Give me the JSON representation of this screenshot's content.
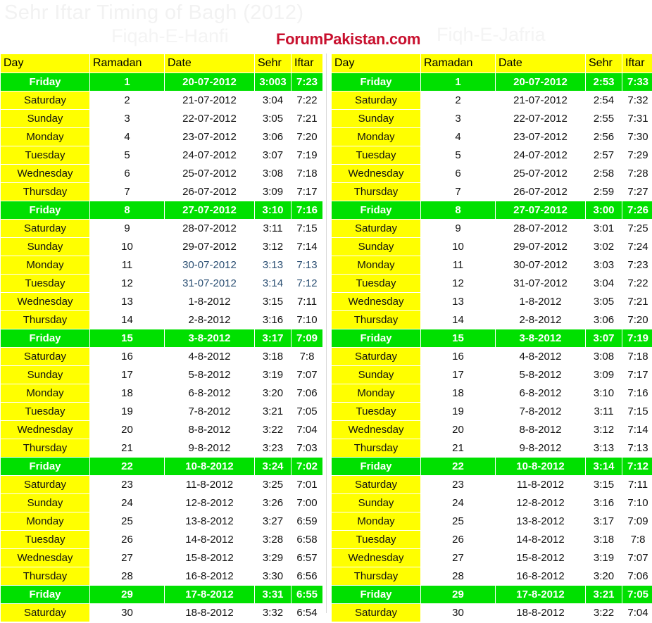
{
  "header": {
    "main_title": "Sehr Iftar Timing of Bagh (2012)",
    "subtitle_left": "Fiqah-E-Hanfi",
    "subtitle_right": "Fiqh-E-Jafria",
    "brand": "ForumPakistan.com",
    "brand_color": "#c8102e",
    "title_color": "#f2f2f2"
  },
  "colors": {
    "header_row_bg": "#ffff00",
    "day_column_bg": "#ffff00",
    "friday_row_bg": "#00e000",
    "friday_row_text": "#ffffff",
    "body_text": "#111111",
    "body_bg": "#ffffff"
  },
  "columns": [
    "Day",
    "Ramadan",
    "Date",
    "Sehr",
    "Iftar"
  ],
  "tables": [
    {
      "id": "hanfi",
      "caption": "Fiqah-E-Hanfi",
      "columns": [
        "Day",
        "Ramadan",
        "Date",
        "Sehr",
        "Iftar"
      ],
      "rows": [
        {
          "day": "Friday",
          "ramadan": "1",
          "date": "20-07-2012",
          "sehr": "3:003",
          "iftar": "7:23",
          "highlight": true
        },
        {
          "day": "Saturday",
          "ramadan": "2",
          "date": "21-07-2012",
          "sehr": "3:04",
          "iftar": "7:22",
          "highlight": false
        },
        {
          "day": "Sunday",
          "ramadan": "3",
          "date": "22-07-2012",
          "sehr": "3:05",
          "iftar": "7:21",
          "highlight": false
        },
        {
          "day": "Monday",
          "ramadan": "4",
          "date": "23-07-2012",
          "sehr": "3:06",
          "iftar": "7:20",
          "highlight": false
        },
        {
          "day": "Tuesday",
          "ramadan": "5",
          "date": "24-07-2012",
          "sehr": "3:07",
          "iftar": "7:19",
          "highlight": false
        },
        {
          "day": "Wednesday",
          "ramadan": "6",
          "date": "25-07-2012",
          "sehr": "3:08",
          "iftar": "7:18",
          "highlight": false
        },
        {
          "day": "Thursday",
          "ramadan": "7",
          "date": "26-07-2012",
          "sehr": "3:09",
          "iftar": "7:17",
          "highlight": false
        },
        {
          "day": "Friday",
          "ramadan": "8",
          "date": "27-07-2012",
          "sehr": "3:10",
          "iftar": "7:16",
          "highlight": true
        },
        {
          "day": "Saturday",
          "ramadan": "9",
          "date": "28-07-2012",
          "sehr": "3:11",
          "iftar": "7:15",
          "highlight": false
        },
        {
          "day": "Sunday",
          "ramadan": "10",
          "date": "29-07-2012",
          "sehr": "3:12",
          "iftar": "7:14",
          "highlight": false
        },
        {
          "day": "Monday",
          "ramadan": "11",
          "date": "30-07-2012",
          "sehr": "3:13",
          "iftar": "7:13",
          "highlight": false,
          "tint": true
        },
        {
          "day": "Tuesday",
          "ramadan": "12",
          "date": "31-07-2012",
          "sehr": "3:14",
          "iftar": "7:12",
          "highlight": false,
          "tint": true
        },
        {
          "day": "Wednesday",
          "ramadan": "13",
          "date": "1-8-2012",
          "sehr": "3:15",
          "iftar": "7:11",
          "highlight": false
        },
        {
          "day": "Thursday",
          "ramadan": "14",
          "date": "2-8-2012",
          "sehr": "3:16",
          "iftar": "7:10",
          "highlight": false
        },
        {
          "day": "Friday",
          "ramadan": "15",
          "date": "3-8-2012",
          "sehr": "3:17",
          "iftar": "7:09",
          "highlight": true
        },
        {
          "day": "Saturday",
          "ramadan": "16",
          "date": "4-8-2012",
          "sehr": "3:18",
          "iftar": "7:8",
          "highlight": false
        },
        {
          "day": "Sunday",
          "ramadan": "17",
          "date": "5-8-2012",
          "sehr": "3:19",
          "iftar": "7:07",
          "highlight": false
        },
        {
          "day": "Monday",
          "ramadan": "18",
          "date": "6-8-2012",
          "sehr": "3:20",
          "iftar": "7:06",
          "highlight": false
        },
        {
          "day": "Tuesday",
          "ramadan": "19",
          "date": "7-8-2012",
          "sehr": "3:21",
          "iftar": "7:05",
          "highlight": false
        },
        {
          "day": "Wednesday",
          "ramadan": "20",
          "date": "8-8-2012",
          "sehr": "3:22",
          "iftar": "7:04",
          "highlight": false
        },
        {
          "day": "Thursday",
          "ramadan": "21",
          "date": "9-8-2012",
          "sehr": "3:23",
          "iftar": "7:03",
          "highlight": false
        },
        {
          "day": "Friday",
          "ramadan": "22",
          "date": "10-8-2012",
          "sehr": "3:24",
          "iftar": "7:02",
          "highlight": true
        },
        {
          "day": "Saturday",
          "ramadan": "23",
          "date": "11-8-2012",
          "sehr": "3:25",
          "iftar": "7:01",
          "highlight": false
        },
        {
          "day": "Sunday",
          "ramadan": "24",
          "date": "12-8-2012",
          "sehr": "3:26",
          "iftar": "7:00",
          "highlight": false
        },
        {
          "day": "Monday",
          "ramadan": "25",
          "date": "13-8-2012",
          "sehr": "3:27",
          "iftar": "6:59",
          "highlight": false
        },
        {
          "day": "Tuesday",
          "ramadan": "26",
          "date": "14-8-2012",
          "sehr": "3:28",
          "iftar": "6:58",
          "highlight": false
        },
        {
          "day": "Wednesday",
          "ramadan": "27",
          "date": "15-8-2012",
          "sehr": "3:29",
          "iftar": "6:57",
          "highlight": false
        },
        {
          "day": "Thursday",
          "ramadan": "28",
          "date": "16-8-2012",
          "sehr": "3:30",
          "iftar": "6:56",
          "highlight": false
        },
        {
          "day": "Friday",
          "ramadan": "29",
          "date": "17-8-2012",
          "sehr": "3:31",
          "iftar": "6:55",
          "highlight": true
        },
        {
          "day": "Saturday",
          "ramadan": "30",
          "date": "18-8-2012",
          "sehr": "3:32",
          "iftar": "6:54",
          "highlight": false
        }
      ]
    },
    {
      "id": "jafria",
      "caption": "Fiqh-E-Jafria",
      "columns": [
        "Day",
        "Ramadan",
        "Date",
        "Sehr",
        "Iftar"
      ],
      "rows": [
        {
          "day": "Friday",
          "ramadan": "1",
          "date": "20-07-2012",
          "sehr": "2:53",
          "iftar": "7:33",
          "highlight": true
        },
        {
          "day": "Saturday",
          "ramadan": "2",
          "date": "21-07-2012",
          "sehr": "2:54",
          "iftar": "7:32",
          "highlight": false
        },
        {
          "day": "Sunday",
          "ramadan": "3",
          "date": "22-07-2012",
          "sehr": "2:55",
          "iftar": "7:31",
          "highlight": false
        },
        {
          "day": "Monday",
          "ramadan": "4",
          "date": "23-07-2012",
          "sehr": "2:56",
          "iftar": "7:30",
          "highlight": false
        },
        {
          "day": "Tuesday",
          "ramadan": "5",
          "date": "24-07-2012",
          "sehr": "2:57",
          "iftar": "7:29",
          "highlight": false
        },
        {
          "day": "Wednesday",
          "ramadan": "6",
          "date": "25-07-2012",
          "sehr": "2:58",
          "iftar": "7:28",
          "highlight": false
        },
        {
          "day": "Thursday",
          "ramadan": "7",
          "date": "26-07-2012",
          "sehr": "2:59",
          "iftar": "7:27",
          "highlight": false
        },
        {
          "day": "Friday",
          "ramadan": "8",
          "date": "27-07-2012",
          "sehr": "3:00",
          "iftar": "7:26",
          "highlight": true
        },
        {
          "day": "Saturday",
          "ramadan": "9",
          "date": "28-07-2012",
          "sehr": "3:01",
          "iftar": "7:25",
          "highlight": false
        },
        {
          "day": "Sunday",
          "ramadan": "10",
          "date": "29-07-2012",
          "sehr": "3:02",
          "iftar": "7:24",
          "highlight": false
        },
        {
          "day": "Monday",
          "ramadan": "11",
          "date": "30-07-2012",
          "sehr": "3:03",
          "iftar": "7:23",
          "highlight": false
        },
        {
          "day": "Tuesday",
          "ramadan": "12",
          "date": "31-07-2012",
          "sehr": "3:04",
          "iftar": "7:22",
          "highlight": false
        },
        {
          "day": "Wednesday",
          "ramadan": "13",
          "date": "1-8-2012",
          "sehr": "3:05",
          "iftar": "7:21",
          "highlight": false
        },
        {
          "day": "Thursday",
          "ramadan": "14",
          "date": "2-8-2012",
          "sehr": "3:06",
          "iftar": "7:20",
          "highlight": false
        },
        {
          "day": "Friday",
          "ramadan": "15",
          "date": "3-8-2012",
          "sehr": "3:07",
          "iftar": "7:19",
          "highlight": true
        },
        {
          "day": "Saturday",
          "ramadan": "16",
          "date": "4-8-2012",
          "sehr": "3:08",
          "iftar": "7:18",
          "highlight": false
        },
        {
          "day": "Sunday",
          "ramadan": "17",
          "date": "5-8-2012",
          "sehr": "3:09",
          "iftar": "7:17",
          "highlight": false
        },
        {
          "day": "Monday",
          "ramadan": "18",
          "date": "6-8-2012",
          "sehr": "3:10",
          "iftar": "7:16",
          "highlight": false
        },
        {
          "day": "Tuesday",
          "ramadan": "19",
          "date": "7-8-2012",
          "sehr": "3:11",
          "iftar": "7:15",
          "highlight": false
        },
        {
          "day": "Wednesday",
          "ramadan": "20",
          "date": "8-8-2012",
          "sehr": "3:12",
          "iftar": "7:14",
          "highlight": false
        },
        {
          "day": "Thursday",
          "ramadan": "21",
          "date": "9-8-2012",
          "sehr": "3:13",
          "iftar": "7:13",
          "highlight": false
        },
        {
          "day": "Friday",
          "ramadan": "22",
          "date": "10-8-2012",
          "sehr": "3:14",
          "iftar": "7:12",
          "highlight": true
        },
        {
          "day": "Saturday",
          "ramadan": "23",
          "date": "11-8-2012",
          "sehr": "3:15",
          "iftar": "7:11",
          "highlight": false
        },
        {
          "day": "Sunday",
          "ramadan": "24",
          "date": "12-8-2012",
          "sehr": "3:16",
          "iftar": "7:10",
          "highlight": false
        },
        {
          "day": "Monday",
          "ramadan": "25",
          "date": "13-8-2012",
          "sehr": "3:17",
          "iftar": "7:09",
          "highlight": false
        },
        {
          "day": "Tuesday",
          "ramadan": "26",
          "date": "14-8-2012",
          "sehr": "3:18",
          "iftar": "7:8",
          "highlight": false
        },
        {
          "day": "Wednesday",
          "ramadan": "27",
          "date": "15-8-2012",
          "sehr": "3:19",
          "iftar": "7:07",
          "highlight": false
        },
        {
          "day": "Thursday",
          "ramadan": "28",
          "date": "16-8-2012",
          "sehr": "3:20",
          "iftar": "7:06",
          "highlight": false
        },
        {
          "day": "Friday",
          "ramadan": "29",
          "date": "17-8-2012",
          "sehr": "3:21",
          "iftar": "7:05",
          "highlight": true
        },
        {
          "day": "Saturday",
          "ramadan": "30",
          "date": "18-8-2012",
          "sehr": "3:22",
          "iftar": "7:04",
          "highlight": false
        }
      ]
    }
  ]
}
